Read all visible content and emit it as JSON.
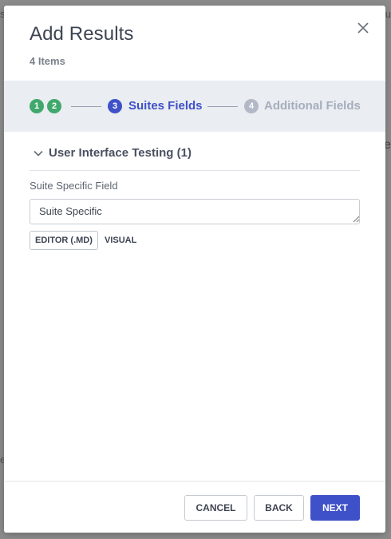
{
  "modal": {
    "title": "Add Results",
    "subtitle": "4 Items"
  },
  "background": {
    "fragments": [
      "sc",
      "su",
      "Te",
      "e"
    ]
  },
  "stepper": {
    "steps": [
      {
        "number": "1",
        "state": "done"
      },
      {
        "number": "2",
        "state": "done"
      },
      {
        "number": "3",
        "label": "Suites Fields",
        "state": "active"
      },
      {
        "number": "4",
        "label": "Additional Fields",
        "state": "pending"
      }
    ]
  },
  "section": {
    "title": "User Interface Testing (1)"
  },
  "field": {
    "label": "Suite Specific Field",
    "value": "Suite Specific"
  },
  "editor_tabs": {
    "md": "EDITOR (.MD)",
    "visual": "VISUAL"
  },
  "footer": {
    "cancel": "CANCEL",
    "back": "BACK",
    "next": "NEXT"
  },
  "colors": {
    "accent": "#3f51c8",
    "done": "#41a86c",
    "pending": "#b2b8c6",
    "stepper_bg": "#eaedf1",
    "backdrop": "#8c8c8c"
  }
}
